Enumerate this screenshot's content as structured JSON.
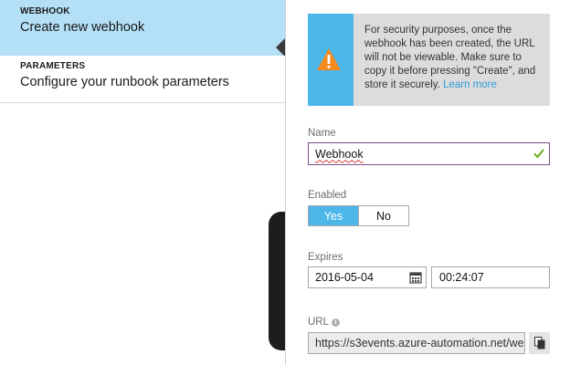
{
  "steps": [
    {
      "caption": "WEBHOOK",
      "title": "Create new webhook",
      "active": true
    },
    {
      "caption": "PARAMETERS",
      "title": "Configure your runbook parameters",
      "active": false
    }
  ],
  "warning": {
    "icon": "warning-triangle-icon",
    "text": "For security purposes, once the webhook has been created, the URL will not be viewable. Make sure to copy it before pressing \"Create\", and store it securely.",
    "link": "Learn more"
  },
  "form": {
    "name_label": "Name",
    "name_value": "Webhook",
    "enabled_label": "Enabled",
    "enabled_yes": "Yes",
    "enabled_no": "No",
    "enabled_selected": "Yes",
    "expires_label": "Expires",
    "expires_date": "2016-05-04",
    "expires_time": "00:24:07",
    "url_label": "URL",
    "url_value": "https://s3events.azure-automation.net/we"
  },
  "colors": {
    "accent": "#4cb6e8",
    "active_step": "#b3e0f7",
    "warning_bg": "#dcdcdc",
    "warning_icon": "#f58a1f",
    "valid_check": "#6aae1c",
    "focus_border": "#7a4f8a"
  }
}
